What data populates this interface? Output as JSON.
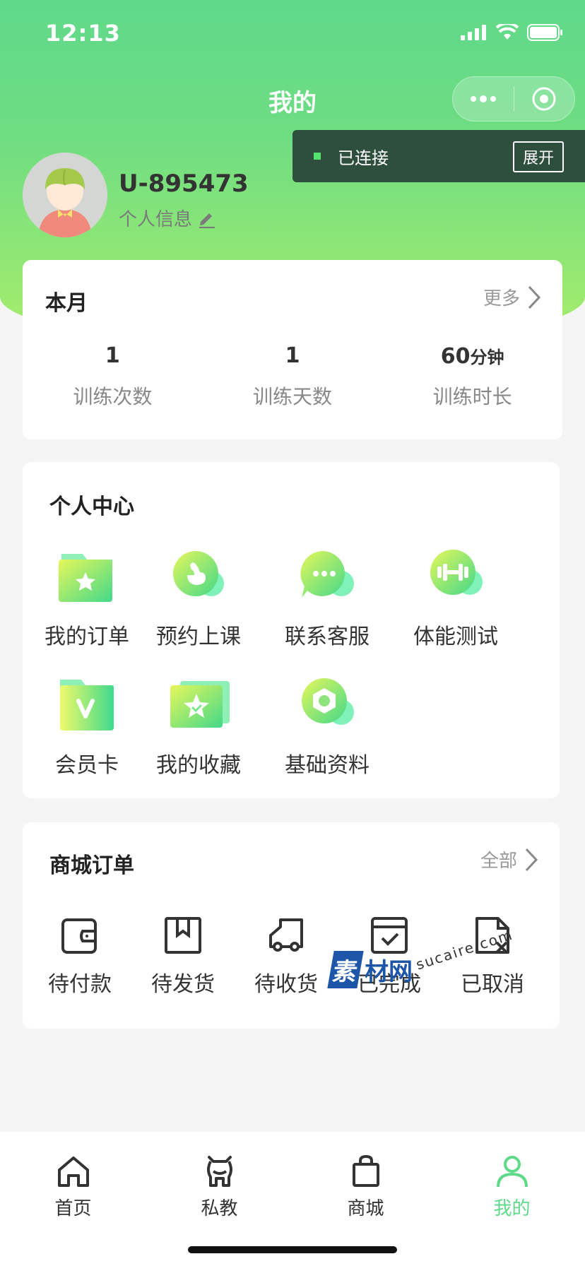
{
  "status_bar": {
    "time": "12:13"
  },
  "nav": {
    "title": "我的"
  },
  "connection": {
    "status": "已连接",
    "expand_label": "展开"
  },
  "profile": {
    "username": "U-895473",
    "info_label": "个人信息"
  },
  "month": {
    "title": "本月",
    "more_label": "更多",
    "stats": [
      {
        "value": "1",
        "unit": "",
        "label": "训练次数"
      },
      {
        "value": "1",
        "unit": "",
        "label": "训练天数"
      },
      {
        "value": "60",
        "unit": "分钟",
        "label": "训练时长"
      }
    ]
  },
  "personal_center": {
    "title": "个人中心",
    "items": [
      {
        "label": "我的订单",
        "icon": "folder-star-icon"
      },
      {
        "label": "预约上课",
        "icon": "muscle-icon"
      },
      {
        "label": "联系客服",
        "icon": "chat-bubble-icon"
      },
      {
        "label": "体能测试",
        "icon": "dumbbell-icon"
      },
      {
        "label": "会员卡",
        "icon": "member-card-icon"
      },
      {
        "label": "我的收藏",
        "icon": "favorite-star-icon"
      },
      {
        "label": "基础资料",
        "icon": "hexagon-nut-icon"
      }
    ]
  },
  "shop_orders": {
    "title": "商城订单",
    "all_label": "全部",
    "items": [
      {
        "label": "待付款",
        "icon": "wallet-icon"
      },
      {
        "label": "待发货",
        "icon": "package-icon"
      },
      {
        "label": "待收货",
        "icon": "truck-icon"
      },
      {
        "label": "已完成",
        "icon": "calendar-check-icon"
      },
      {
        "label": "已取消",
        "icon": "file-cancel-icon"
      }
    ]
  },
  "watermark": {
    "logo": "素",
    "text": "材网",
    "url": "sucaire.com"
  },
  "tabs": [
    {
      "label": "首页",
      "icon": "home-icon"
    },
    {
      "label": "私教",
      "icon": "coach-icon"
    },
    {
      "label": "商城",
      "icon": "shopping-bag-icon"
    },
    {
      "label": "我的",
      "icon": "user-icon"
    }
  ],
  "colors": {
    "accent": "#5fd98a",
    "header_top": "#5fd98a",
    "header_bottom": "#a8ee6a",
    "banner": "#2f4f3e"
  }
}
